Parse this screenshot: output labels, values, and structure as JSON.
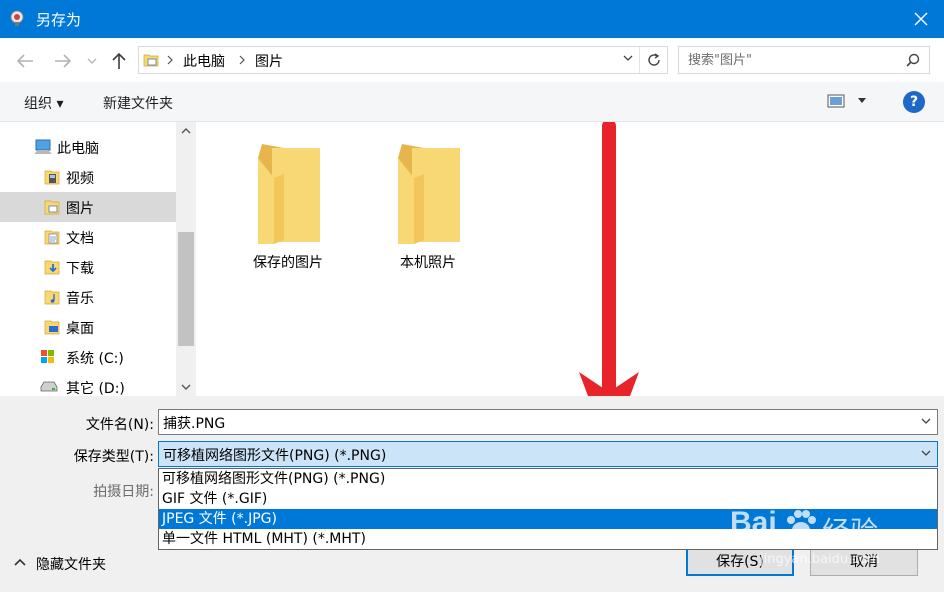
{
  "window": {
    "title": "另存为"
  },
  "address": {
    "crumbs": [
      "此电脑",
      "图片"
    ]
  },
  "search": {
    "placeholder": "搜索\"图片\""
  },
  "toolbar": {
    "organize": "组织 ▾",
    "new_folder": "新建文件夹",
    "help": "?"
  },
  "sidebar": {
    "items": [
      {
        "label": "此电脑",
        "icon": "computer-icon"
      },
      {
        "label": "视频",
        "icon": "video-folder-icon"
      },
      {
        "label": "图片",
        "icon": "pictures-folder-icon",
        "selected": true
      },
      {
        "label": "文档",
        "icon": "documents-folder-icon"
      },
      {
        "label": "下载",
        "icon": "downloads-folder-icon"
      },
      {
        "label": "音乐",
        "icon": "music-folder-icon"
      },
      {
        "label": "桌面",
        "icon": "desktop-folder-icon"
      },
      {
        "label": "系统 (C:)",
        "icon": "system-drive-icon"
      },
      {
        "label": "其它 (D:)",
        "icon": "drive-icon"
      }
    ]
  },
  "folders": [
    {
      "name": "保存的图片"
    },
    {
      "name": "本机照片"
    }
  ],
  "form": {
    "filename_label": "文件名(N):",
    "filename_value": "捕获.PNG",
    "filetype_label": "保存类型(T):",
    "filetype_value": "可移植网络图形文件(PNG) (*.PNG)",
    "date_label": "拍摄日期:",
    "filetype_options": [
      "可移植网络图形文件(PNG) (*.PNG)",
      "GIF 文件 (*.GIF)",
      "JPEG 文件 (*.JPG)",
      "单一文件 HTML (MHT) (*.MHT)"
    ],
    "highlighted_option_index": 2
  },
  "footer": {
    "hide_folders": "隐藏文件夹",
    "save": "保存(S)",
    "cancel": "取消"
  },
  "watermark": {
    "brand": "Bai",
    "brand2": "经验",
    "url": "jingyan.baidu.com"
  },
  "colors": {
    "titlebar": "#0078d7",
    "folder": "#f8d775",
    "arrow": "#e8232a",
    "highlight": "#0078d7"
  }
}
